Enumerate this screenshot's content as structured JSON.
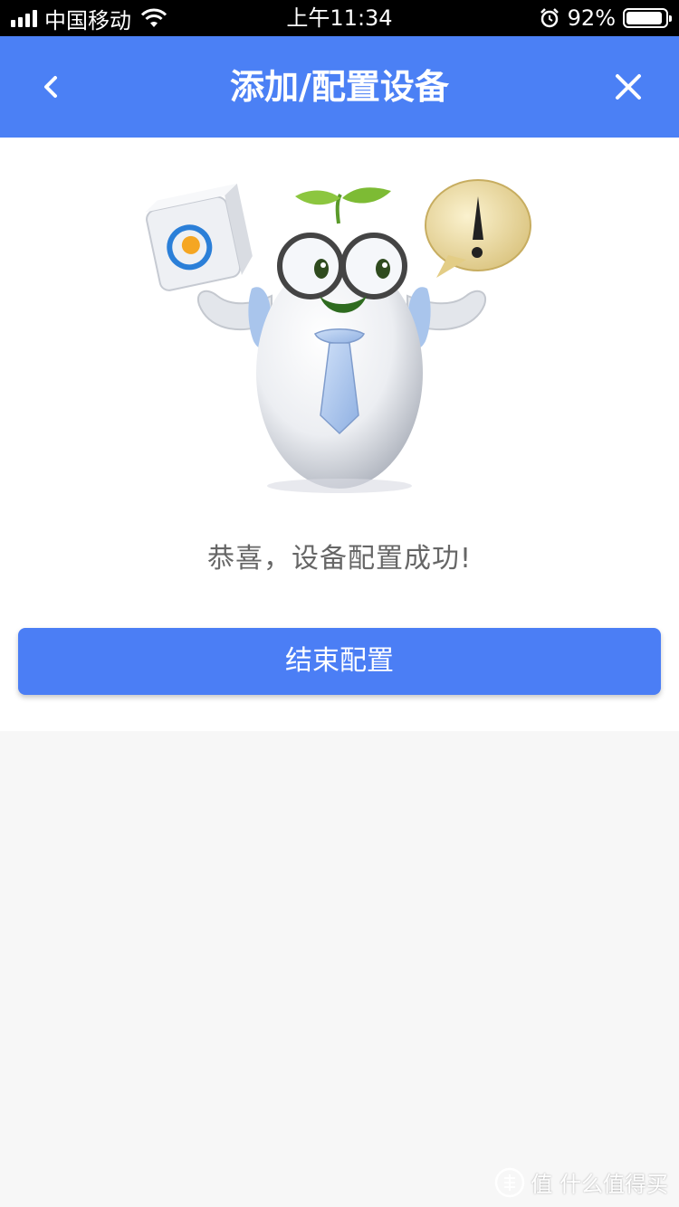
{
  "status_bar": {
    "carrier": "中国移动",
    "time": "上午11:34",
    "battery_percent": "92%",
    "battery_level": 0.92,
    "icons": [
      "signal-icon",
      "wifi-icon",
      "alarm-icon",
      "battery-icon"
    ]
  },
  "nav": {
    "title": "添加/配置设备",
    "back_icon": "chevron-left-icon",
    "close_icon": "close-icon"
  },
  "main": {
    "success_message": "恭喜，设备配置成功!",
    "finish_button_label": "结束配置"
  },
  "watermark": {
    "text": "值 什么值得买"
  },
  "colors": {
    "accent": "#4b80f5",
    "button": "#4b7ef5",
    "message_text": "#666666",
    "page_background": "#f7f7f7"
  }
}
